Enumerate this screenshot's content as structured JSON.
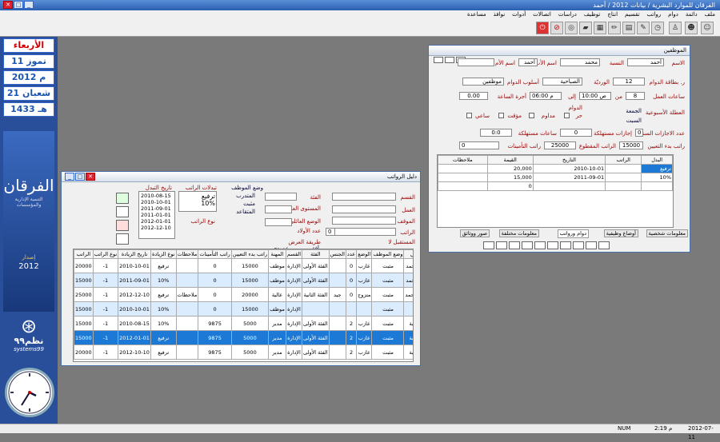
{
  "window": {
    "title": "الفرقان للموارد البشرية / بيانات 2012 / أحمد"
  },
  "menu": [
    "ملف",
    "دائمة",
    "دوام",
    "رواتب",
    "تقسيم",
    "انتاج",
    "توظيف",
    "دراسات",
    "اتصالات",
    "أدوات",
    "نوافذ",
    "مساعدة"
  ],
  "sidebar": {
    "day": "الأربعاء",
    "greg_date": "11 تموز",
    "greg_year": "2012 م",
    "hijri_date": "21 شعبان",
    "hijri_year": "1433 هـ",
    "logo_title": "الفرقان",
    "logo_sub": "التنمية الإدارية والمؤسسات",
    "version_label": "إصدار",
    "version_year": "2012",
    "systems_logo": "نظم٩٩",
    "systems_latin": "systems99"
  },
  "status": {
    "num": "NUM",
    "time": "2:19 م",
    "date": "2012-07-11"
  },
  "employees_window": {
    "title": "الموظفين",
    "labels": {
      "name": "الاسم",
      "surname": "النسبة",
      "father": "اسم الأب",
      "mother": "اسم الأم",
      "card": "ر. بطاقة الدوام",
      "shift": "الورديّة",
      "method": "أسلوب الدوام",
      "hours": "ساعات العمل",
      "from": "من",
      "to": "إلى",
      "hour_wage": "أجرة الساعة",
      "weekly": "العطلة الأسبوعية",
      "duty": "الدوام",
      "free": "حر",
      "continuous": "مداوم",
      "temporary": "مؤقت",
      "hourly": "ساعي",
      "vac_days": "عدد الاجازات السنوية",
      "vac_used": "إجازات مستهلكة",
      "hours_used": "ساعات مستهلكة",
      "start_salary": "راتب بدء التعيين",
      "cut_salary": "الراتب المقطوع",
      "insurance_salary": "راتب التأمينات"
    },
    "values": {
      "name": "أحمد",
      "surname": "محمد",
      "father": "أحمد",
      "mother": "",
      "card": "12",
      "shift": "الصباحية",
      "method": "موظفين",
      "hours": "8",
      "from": "10:00 ص",
      "to": "06:00 م",
      "hour_wage": "0.00",
      "hours_zero": "0",
      "day1": "الجمعة",
      "day2": "السبت",
      "vac_days": "0",
      "vac_used": "0",
      "hours_used": "0:0",
      "start_salary": "15000",
      "cut_salary": "25000",
      "insurance_salary": "0"
    },
    "grid": {
      "headers": [
        "البدل",
        "الراتب",
        "التاريخ",
        "القيمة",
        "ملاحظات"
      ],
      "rows": [
        [
          "ترفيع",
          "",
          "2010-10-01",
          "20,000",
          ""
        ],
        [
          "10%",
          "",
          "2011-09-01",
          "15,000",
          ""
        ],
        [
          "",
          "",
          "",
          "0",
          ""
        ]
      ]
    },
    "tabs": [
      "معلومات شخصية",
      "أوضاع وظيفية",
      "دوام ورواتب",
      "معلومات مختلفة",
      "صور ووثائق"
    ]
  },
  "salary_window": {
    "title": "دليل الرواتب",
    "filters": {
      "dept": "القسم",
      "work": "العمل",
      "position": "الموقف",
      "salary": "الراتب",
      "future": "المستقبل لا",
      "category": "الفئة",
      "edu": "المستوى العلمي",
      "family": "الوضع العائلي",
      "kids": "عدد الأولاد",
      "kids_val": "0",
      "order": "طريقة العرض",
      "horiz": "أفقي",
      "vert": "عمودي",
      "job_status": "وضع الموظف",
      "trainee": "المتدرب",
      "fixed": "مثبت",
      "retired": "المتقاعد",
      "changes": "تبدلات الراتب",
      "promotion": "ترفيع",
      "percent": "10%",
      "salary_type": "نوع الراتب",
      "date_change": "تاريخ التبدل"
    },
    "dates": [
      "2010-08-15",
      "2010-10-01",
      "2011-09-01",
      "2011-01-01",
      "2012-01-01",
      "2012-12-10"
    ],
    "headers": [
      "",
      "",
      "الموظف",
      "الاسم الثلاثي",
      "وضع الموظف",
      "الوضع",
      "عدد",
      "الجنس",
      "الفئة",
      "القسم",
      "المهنة",
      "راتب بدء التعيين",
      "راتب التأمينات",
      "ملاحظات",
      "نوع الزيادة",
      "تاريخ الزيادة",
      "نوع الراتب",
      "الراتب"
    ],
    "rows": [
      [
        "",
        "1",
        "أحمد محمد",
        "أحمد أحمد محمد",
        "مثبت",
        "عازب",
        "0",
        "",
        "الفئة الأولى",
        "الإدارة",
        "موظف",
        "15000",
        "0",
        "",
        "ترفيع",
        "2010-10-01",
        "1-",
        "20000"
      ],
      [
        "",
        "2",
        "أحمد محمد",
        "أحمد أحمد محمد",
        "مثبت",
        "عازب",
        "0",
        "",
        "الفئة الأولى",
        "الإدارة",
        "موظف",
        "15000",
        "0",
        "",
        "10%",
        "2011-09-01",
        "1-",
        "15000"
      ],
      [
        "",
        "3",
        "محمد أحمد",
        "محمد محمد أحمد",
        "مثبت",
        "متزوج",
        "0",
        "جيد",
        "الفئة الثانية",
        "الإدارة",
        "عالية",
        "20000",
        "0",
        "ملاحظات",
        "ترفيع",
        "2012-12-10",
        "1-",
        "25000"
      ],
      [
        "",
        "4",
        "عبد الله",
        "عبد الله",
        "مثبت",
        "",
        "",
        "",
        "",
        "الإدارة",
        "موظف",
        "15000",
        "0",
        "",
        "10%",
        "2010-10-01",
        "1-",
        "15000"
      ],
      [
        "",
        "5",
        "اسم اب نسبة",
        "اسم اب نسبة",
        "مثبت",
        "عازب",
        "2",
        "",
        "الفئة الأولى",
        "الإدارة",
        "مدير",
        "5000",
        "9875",
        "",
        "10%",
        "2010-08-15",
        "1-",
        "15000"
      ],
      [
        "▶",
        "6",
        "اسم اب نسبة",
        "اسم اب نسبة",
        "مثبت",
        "عازب",
        "2",
        "",
        "الفئة الأولى",
        "الإدارة",
        "مدير",
        "5000",
        "9875",
        "",
        "ترفيع",
        "2012-01-01",
        "1-",
        "15000"
      ],
      [
        "",
        "7",
        "اسم اب نسبة",
        "اسم اب نسبة",
        "مثبت",
        "عازب",
        "2",
        "",
        "الفئة الأولى",
        "الإدارة",
        "مدير",
        "5000",
        "9875",
        "",
        "ترفيع",
        "2012-10-10",
        "1-",
        "20000"
      ]
    ]
  }
}
